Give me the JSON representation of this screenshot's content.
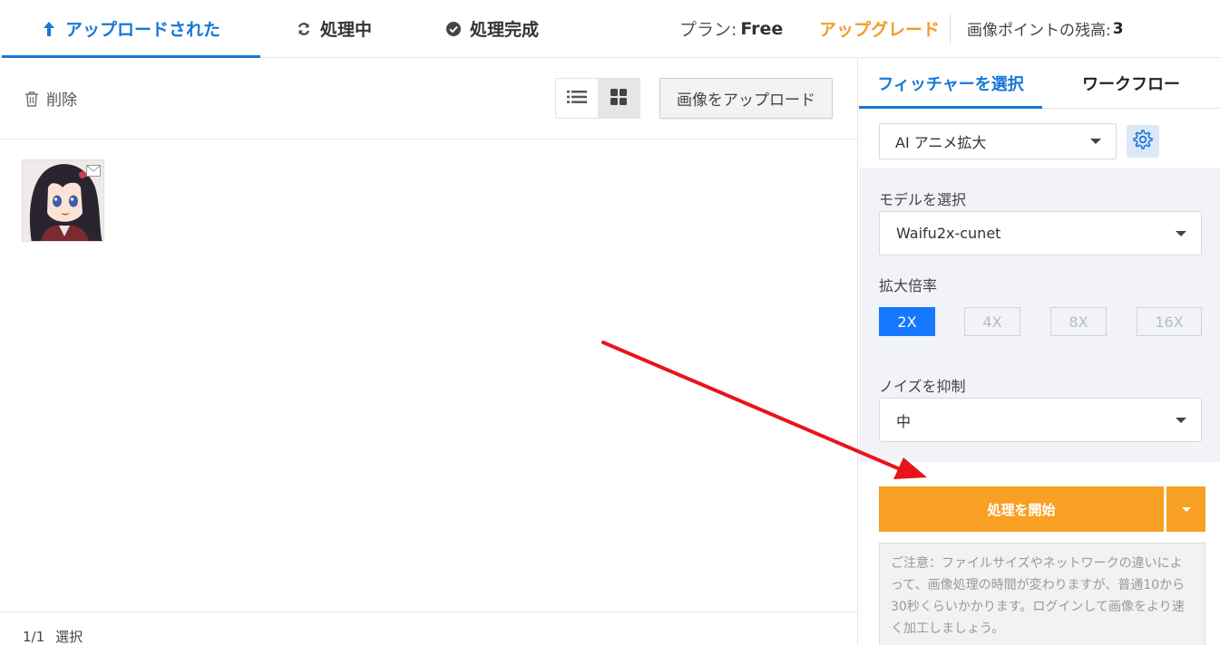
{
  "header": {
    "tabs": [
      {
        "label": "アップロードされた",
        "icon": "upload-arrow-icon",
        "active": true
      },
      {
        "label": "処理中",
        "icon": "refresh-icon",
        "active": false
      },
      {
        "label": "処理完成",
        "icon": "check-circle-icon",
        "active": false
      }
    ],
    "plan_label": "プラン:",
    "plan_value": "Free",
    "upgrade_label": "アップグレード",
    "points_label": "画像ポイントの残高:",
    "points_value": "3"
  },
  "toolbar": {
    "delete_label": "削除",
    "view_modes": [
      "list",
      "grid"
    ],
    "active_view": "grid",
    "upload_label": "画像をアップロード"
  },
  "images": [
    {
      "name": "anime-girl-thumbnail"
    }
  ],
  "footer": {
    "count": "1/1",
    "select_label": "選択"
  },
  "panel": {
    "tabs": [
      {
        "label": "フィッチャーを選択",
        "active": true
      },
      {
        "label": "ワークフロー",
        "active": false
      }
    ],
    "feature_value": "AI アニメ拡大",
    "model_label": "モデルを選択",
    "model_value": "Waifu2x-cunet",
    "scale_label": "拡大倍率",
    "scales": [
      {
        "label": "2X",
        "active": true
      },
      {
        "label": "4X",
        "active": false
      },
      {
        "label": "8X",
        "active": false
      },
      {
        "label": "16X",
        "active": false
      }
    ],
    "noise_label": "ノイズを抑制",
    "noise_value": "中",
    "start_label": "処理を開始",
    "notice": "ご注意：ファイルサイズやネットワークの違いによって、画像処理の時間が変わりますが、普通10から30秒くらいかかります。ログインして画像をより速く加工しましょう。"
  },
  "colors": {
    "accent_blue": "#1677d8",
    "accent_orange": "#f8a023",
    "annotation_arrow": "#e8141b"
  }
}
